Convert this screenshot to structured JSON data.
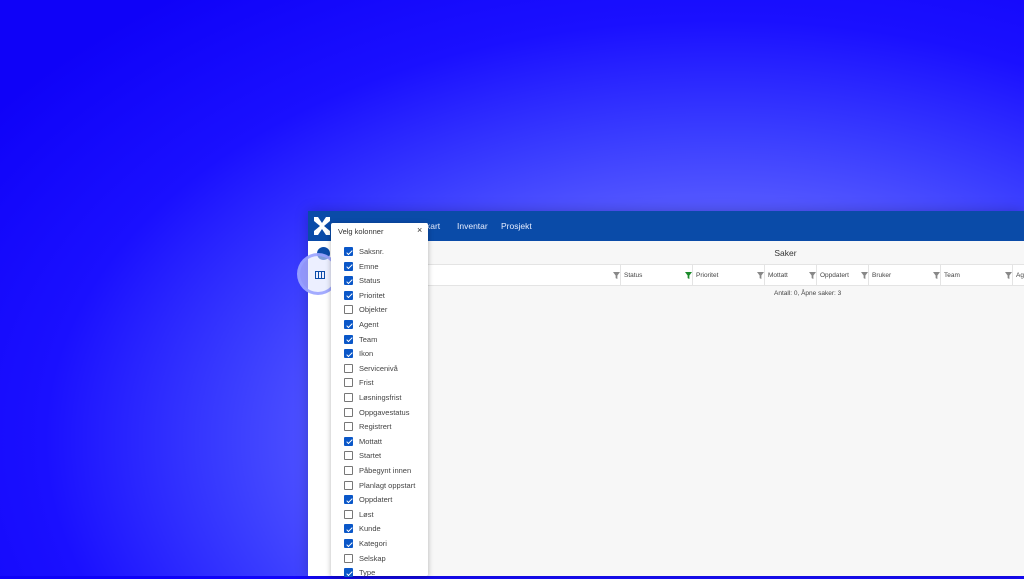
{
  "nav": {
    "items": [
      {
        "label": "kart"
      },
      {
        "label": "Inventar"
      },
      {
        "label": "Prosjekt"
      }
    ]
  },
  "sidebar": {
    "columns_icon": "columns-icon",
    "add_icon": "plus-icon"
  },
  "main": {
    "title": "Saker",
    "columns": [
      {
        "label": "Status",
        "filtered": false
      },
      {
        "label": "Prioritet",
        "filtered": true
      },
      {
        "label": "Mottatt",
        "filtered": false
      },
      {
        "label": "Oppdatert",
        "filtered": false
      },
      {
        "label": "Bruker",
        "filtered": false
      },
      {
        "label": "Team",
        "filtered": false
      },
      {
        "label": "Ag",
        "filtered": false
      }
    ],
    "count_text": "Antall: 0, Åpne saker: 3"
  },
  "column_picker": {
    "title": "Velg kolonner",
    "close": "×",
    "options": [
      {
        "label": "Saksnr.",
        "checked": true
      },
      {
        "label": "Emne",
        "checked": true
      },
      {
        "label": "Status",
        "checked": true
      },
      {
        "label": "Prioritet",
        "checked": true
      },
      {
        "label": "Objekter",
        "checked": false
      },
      {
        "label": "Agent",
        "checked": true
      },
      {
        "label": "Team",
        "checked": true
      },
      {
        "label": "Ikon",
        "checked": true
      },
      {
        "label": "Servicenivå",
        "checked": false
      },
      {
        "label": "Frist",
        "checked": false
      },
      {
        "label": "Løsningsfrist",
        "checked": false
      },
      {
        "label": "Oppgavestatus",
        "checked": false
      },
      {
        "label": "Registrert",
        "checked": false
      },
      {
        "label": "Mottatt",
        "checked": true
      },
      {
        "label": "Startet",
        "checked": false
      },
      {
        "label": "Påbegynt innen",
        "checked": false
      },
      {
        "label": "Planlagt oppstart",
        "checked": false
      },
      {
        "label": "Oppdatert",
        "checked": true
      },
      {
        "label": "Løst",
        "checked": false
      },
      {
        "label": "Kunde",
        "checked": true
      },
      {
        "label": "Kategori",
        "checked": true
      },
      {
        "label": "Selskap",
        "checked": false
      },
      {
        "label": "Type",
        "checked": true
      }
    ]
  },
  "colors": {
    "brand": "#0a4ba8",
    "checkbox_on": "#0a57c8",
    "filter_active": "#1a8a2a",
    "filter_idle": "#888888"
  }
}
